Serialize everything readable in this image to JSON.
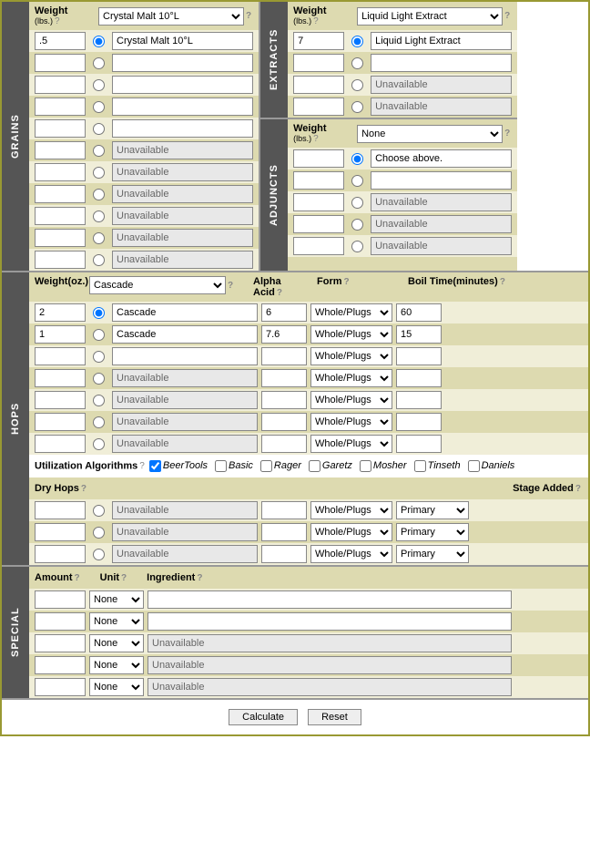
{
  "grains": {
    "label": "GRAINS",
    "weight_label": "Weight",
    "weight_sub": "(lbs.)",
    "selector": "Crystal Malt 10°L",
    "rows": [
      {
        "wt": ".5",
        "nm": "Crystal Malt 10°L",
        "dis": false,
        "sel": true
      },
      {
        "wt": "",
        "nm": "",
        "dis": false,
        "sel": false
      },
      {
        "wt": "",
        "nm": "",
        "dis": false,
        "sel": false
      },
      {
        "wt": "",
        "nm": "",
        "dis": false,
        "sel": false
      },
      {
        "wt": "",
        "nm": "",
        "dis": false,
        "sel": false
      },
      {
        "wt": "",
        "nm": "Unavailable",
        "dis": true,
        "sel": false
      },
      {
        "wt": "",
        "nm": "Unavailable",
        "dis": true,
        "sel": false
      },
      {
        "wt": "",
        "nm": "Unavailable",
        "dis": true,
        "sel": false
      },
      {
        "wt": "",
        "nm": "Unavailable",
        "dis": true,
        "sel": false
      },
      {
        "wt": "",
        "nm": "Unavailable",
        "dis": true,
        "sel": false
      },
      {
        "wt": "",
        "nm": "Unavailable",
        "dis": true,
        "sel": false
      }
    ]
  },
  "extracts": {
    "label": "EXTRACTS",
    "weight_label": "Weight",
    "weight_sub": "(lbs.)",
    "selector": "Liquid Light Extract",
    "rows": [
      {
        "wt": "7",
        "nm": "Liquid Light Extract",
        "dis": false,
        "sel": true
      },
      {
        "wt": "",
        "nm": "",
        "dis": false,
        "sel": false
      },
      {
        "wt": "",
        "nm": "Unavailable",
        "dis": true,
        "sel": false
      },
      {
        "wt": "",
        "nm": "Unavailable",
        "dis": true,
        "sel": false
      }
    ]
  },
  "adjuncts": {
    "label": "ADJUNCTS",
    "weight_label": "Weight",
    "weight_sub": "(lbs.)",
    "selector": "None",
    "rows": [
      {
        "wt": "",
        "nm": "Choose above.",
        "dis": false,
        "sel": true
      },
      {
        "wt": "",
        "nm": "",
        "dis": false,
        "sel": false
      },
      {
        "wt": "",
        "nm": "Unavailable",
        "dis": true,
        "sel": false
      },
      {
        "wt": "",
        "nm": "Unavailable",
        "dis": true,
        "sel": false
      },
      {
        "wt": "",
        "nm": "Unavailable",
        "dis": true,
        "sel": false
      }
    ]
  },
  "hops": {
    "label": "HOPS",
    "weight_label": "Weight",
    "weight_sub": "(oz.)",
    "alpha_label": "Alpha Acid",
    "form_label": "Form",
    "boil_label": "Boil Time",
    "boil_sub": "(minutes)",
    "selector": "Cascade",
    "form_opt": "Whole/Plugs",
    "rows": [
      {
        "wt": "2",
        "nm": "Cascade",
        "aa": "6",
        "bt": "60",
        "dis": false,
        "sel": true
      },
      {
        "wt": "1",
        "nm": "Cascade",
        "aa": "7.6",
        "bt": "15",
        "dis": false,
        "sel": false
      },
      {
        "wt": "",
        "nm": "",
        "aa": "",
        "bt": "",
        "dis": false,
        "sel": false
      },
      {
        "wt": "",
        "nm": "Unavailable",
        "aa": "",
        "bt": "",
        "dis": true,
        "sel": false
      },
      {
        "wt": "",
        "nm": "Unavailable",
        "aa": "",
        "bt": "",
        "dis": true,
        "sel": false
      },
      {
        "wt": "",
        "nm": "Unavailable",
        "aa": "",
        "bt": "",
        "dis": true,
        "sel": false
      },
      {
        "wt": "",
        "nm": "Unavailable",
        "aa": "",
        "bt": "",
        "dis": true,
        "sel": false
      }
    ],
    "util_label": "Utilization Algorithms",
    "util": [
      {
        "name": "BeerTools",
        "chk": true
      },
      {
        "name": "Basic",
        "chk": false
      },
      {
        "name": "Rager",
        "chk": false
      },
      {
        "name": "Garetz",
        "chk": false
      },
      {
        "name": "Mosher",
        "chk": false
      },
      {
        "name": "Tinseth",
        "chk": false
      },
      {
        "name": "Daniels",
        "chk": false
      }
    ],
    "dry_label": "Dry Hops",
    "stage_label": "Stage Added",
    "stage_opt": "Primary",
    "dry": [
      {
        "nm": "Unavailable"
      },
      {
        "nm": "Unavailable"
      },
      {
        "nm": "Unavailable"
      }
    ]
  },
  "special": {
    "label": "SPECIAL",
    "amount_label": "Amount",
    "unit_label": "Unit",
    "ing_label": "Ingredient",
    "unit_opt": "None",
    "rows": [
      {
        "ing": "",
        "dis": false
      },
      {
        "ing": "",
        "dis": false
      },
      {
        "ing": "Unavailable",
        "dis": true
      },
      {
        "ing": "Unavailable",
        "dis": true
      },
      {
        "ing": "Unavailable",
        "dis": true
      }
    ]
  },
  "buttons": {
    "calc": "Calculate",
    "reset": "Reset"
  }
}
